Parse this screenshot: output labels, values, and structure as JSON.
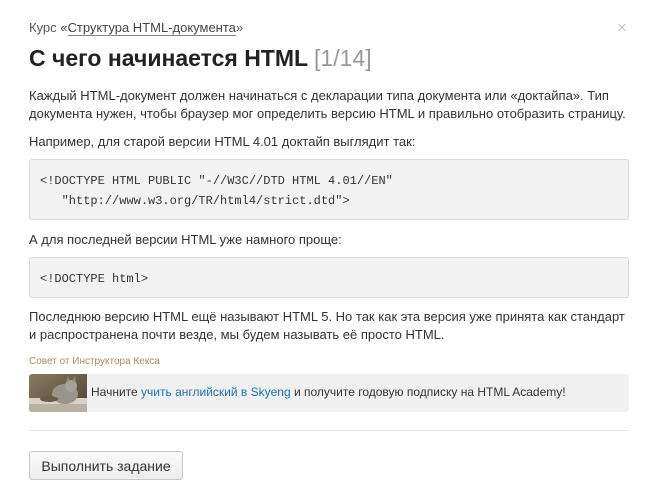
{
  "header": {
    "course_prefix": "Курс «",
    "course_link": "Структура HTML-документа",
    "course_suffix": "»",
    "close_glyph": "×",
    "title": "С чего начинается HTML",
    "counter": "[1/14]"
  },
  "content": {
    "p1": "Каждый HTML-документ должен начинаться с декларации типа документа или «доктайпа». Тип документа нужен, чтобы браузер мог определить версию HTML и правильно отобразить страницу.",
    "p2": "Например, для старой версии HTML 4.01 доктайп выглядит так:",
    "code1": "<!DOCTYPE HTML PUBLIC \"-//W3C//DTD HTML 4.01//EN\"\n   \"http://www.w3.org/TR/html4/strict.dtd\">",
    "p3": "А для последней версии HTML уже намного проще:",
    "code2": "<!DOCTYPE html>",
    "p4": "Последнюю версию HTML ещё называют HTML 5. Но так как эта версия уже принята как стандарт и распространена почти везде, мы будем называть её просто HTML."
  },
  "tip": {
    "label": "Совет от Инструктора Кекса",
    "text_before": "Начните ",
    "link_text": "учить английский в Skyeng",
    "text_after": " и получите годовую подписку на HTML Academy!"
  },
  "actions": {
    "submit_label": "Выполнить задание"
  },
  "colors": {
    "link": "#1a73b8",
    "tip_label": "#a89060",
    "code_bg": "#f2f2f2"
  }
}
